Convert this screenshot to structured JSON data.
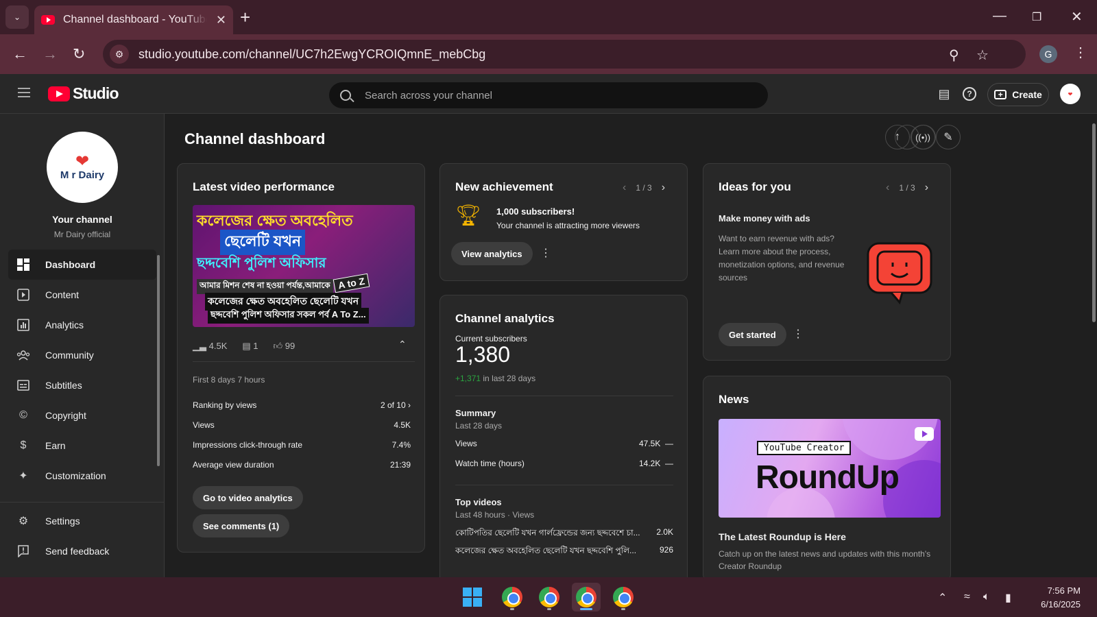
{
  "browser": {
    "tab_title": "Channel dashboard - YouTube Studio",
    "url": "studio.youtube.com/channel/UC7h2EwgYCROIQmnE_mebCbg",
    "profile_initial": "G"
  },
  "header": {
    "logo_text": "Studio",
    "search_placeholder": "Search across your channel",
    "create_label": "Create"
  },
  "sidebar": {
    "channel_logo_text": "M r Dairy",
    "channel_title": "Your channel",
    "channel_name": "Mr Dairy official",
    "items": [
      {
        "label": "Dashboard",
        "icon": "dashboard-icon"
      },
      {
        "label": "Content",
        "icon": "content-icon"
      },
      {
        "label": "Analytics",
        "icon": "analytics-icon"
      },
      {
        "label": "Community",
        "icon": "community-icon"
      },
      {
        "label": "Subtitles",
        "icon": "subtitles-icon"
      },
      {
        "label": "Copyright",
        "icon": "copyright-icon"
      },
      {
        "label": "Earn",
        "icon": "earn-icon"
      },
      {
        "label": "Customization",
        "icon": "customization-icon"
      }
    ],
    "bottom_items": [
      {
        "label": "Settings",
        "icon": "settings-icon"
      },
      {
        "label": "Send feedback",
        "icon": "feedback-icon"
      }
    ]
  },
  "main": {
    "title": "Channel dashboard",
    "latest": {
      "title": "Latest video performance",
      "thumb_lines": [
        "কলেজের ক্ষেত অবহেলিত",
        "ছেলেটি যখন",
        "ছদ্দবেশি পুলিশ অফিসার",
        "আমার মিশন শেষ না হওয়া পর্যন্ত,আমাকে",
        "কলেজের ক্ষেত অবহেলিত ছেলেটি যখন",
        "ছদ্দবেশি পুলিশ অফিসার সকল পর্ব A To Z..."
      ],
      "thumb_badge": "A to Z",
      "views": "4.5K",
      "comments": "1",
      "likes": "99",
      "period": "First 8 days 7 hours",
      "ranking_label": "Ranking by views",
      "ranking_value": "2 of 10",
      "views_label": "Views",
      "views_value": "4.5K",
      "ctr_label": "Impressions click-through rate",
      "ctr_value": "7.4%",
      "avd_label": "Average view duration",
      "avd_value": "21:39",
      "btn_analytics": "Go to video analytics",
      "btn_comments": "See comments (1)"
    },
    "achievement": {
      "title": "New achievement",
      "pager": "1 / 3",
      "headline": "1,000 subscribers!",
      "text": "Your channel is attracting more viewers",
      "button": "View analytics"
    },
    "analytics": {
      "title": "Channel analytics",
      "subs_label": "Current subscribers",
      "subs_value": "1,380",
      "subs_delta": "+1,371",
      "subs_delta_text": "in last 28 days",
      "summary_title": "Summary",
      "summary_period": "Last 28 days",
      "views_label": "Views",
      "views_value": "47.5K",
      "watch_label": "Watch time (hours)",
      "watch_value": "14.2K",
      "dash": "—",
      "top_title": "Top videos",
      "top_period": "Last 48 hours · Views",
      "top_videos": [
        {
          "title": "কোটিপতির ছেলেটি যখন গার্লফ্রেন্ডের জন্য ছদ্দবেশে চা...",
          "views": "2.0K"
        },
        {
          "title": "কলেজের ক্ষেত অবহেলিত ছেলেটি যখন ছদ্দবেশি পুলি...",
          "views": "926"
        }
      ]
    },
    "ideas": {
      "title": "Ideas for you",
      "pager": "1 / 3",
      "headline": "Make money with ads",
      "text": "Want to earn revenue with ads? Learn more about the process, monetization options, and revenue sources",
      "button": "Get started"
    },
    "news": {
      "title": "News",
      "img_label": "YouTube Creator",
      "img_title": "RoundUp",
      "headline": "The Latest Roundup is Here",
      "text": "Catch up on the latest news and updates with this month's Creator Roundup"
    }
  },
  "taskbar": {
    "time": "7:56 PM",
    "date": "6/16/2025"
  },
  "colors": {
    "accent_red": "#ff0033",
    "positive_green": "#2ba640",
    "browser_frame": "#5a2c3a"
  }
}
